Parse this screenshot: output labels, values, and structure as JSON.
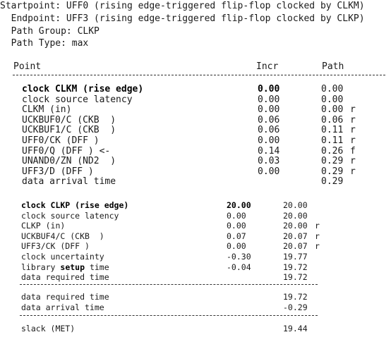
{
  "header": {
    "startpoint": "Startpoint: UFF0 (rising edge-triggered flip-flop clocked by CLKM)",
    "endpoint": "  Endpoint: UFF3 (rising edge-triggered flip-flop clocked by CLKP)",
    "path_group": "  Path Group: CLKP",
    "path_type": "  Path Type: max"
  },
  "columns": {
    "point": "Point",
    "incr": "Incr",
    "path": "Path"
  },
  "launch_rows": [
    {
      "point": "clock CLKM (rise edge)",
      "incr": "0.00",
      "path": "0.00",
      "flag": "",
      "bold": true
    },
    {
      "point": "clock source latency",
      "incr": "0.00",
      "path": "0.00",
      "flag": ""
    },
    {
      "point": "CLKM (in)",
      "incr": "0.00",
      "path": "0.00",
      "flag": "r"
    },
    {
      "point": "UCKBUF0/C (CKB  )",
      "incr": "0.06",
      "path": "0.06",
      "flag": "r"
    },
    {
      "point": "UCKBUF1/C (CKB  )",
      "incr": "0.06",
      "path": "0.11",
      "flag": "r"
    },
    {
      "point": "UFF0/CK (DFF )",
      "incr": "0.00",
      "path": "0.11",
      "flag": "r"
    },
    {
      "point": "UFF0/Q (DFF ) <-",
      "incr": "0.14",
      "path": "0.26",
      "flag": "f"
    },
    {
      "point": "UNAND0/ZN (ND2  )",
      "incr": "0.03",
      "path": "0.29",
      "flag": "r"
    },
    {
      "point": "UFF3/D (DFF )",
      "incr": "0.00",
      "path": "0.29",
      "flag": "r"
    },
    {
      "point": "data arrival time",
      "incr": "",
      "path": "0.29",
      "flag": ""
    }
  ],
  "capture_rows": [
    {
      "point": "clock CLKP (rise edge)",
      "incr": "20.00",
      "path": "20.00",
      "flag": "",
      "bold": true
    },
    {
      "point": "clock source latency",
      "incr": "0.00",
      "path": "20.00",
      "flag": ""
    },
    {
      "point": "CLKP (in)",
      "incr": "0.00",
      "path": "20.00",
      "flag": "r"
    },
    {
      "point": "UCKBUF4/C (CKB  )",
      "incr": "0.07",
      "path": "20.07",
      "flag": "r"
    },
    {
      "point": "UFF3/CK (DFF )",
      "incr": "0.00",
      "path": "20.07",
      "flag": "r"
    },
    {
      "point": "clock uncertainty",
      "incr": "-0.30",
      "path": "19.77",
      "flag": ""
    },
    {
      "point_pre": "library ",
      "point_bold": "setup",
      "point_post": " time",
      "incr": "-0.04",
      "path": "19.72",
      "flag": ""
    },
    {
      "point": "data required time",
      "incr": "",
      "path": "19.72",
      "flag": ""
    }
  ],
  "summary_rows": [
    {
      "point": "data required time",
      "path": "19.72"
    },
    {
      "point": "data arrival time",
      "path": "-0.29"
    }
  ],
  "slack": {
    "point": "slack (MET)",
    "path": "19.44"
  }
}
